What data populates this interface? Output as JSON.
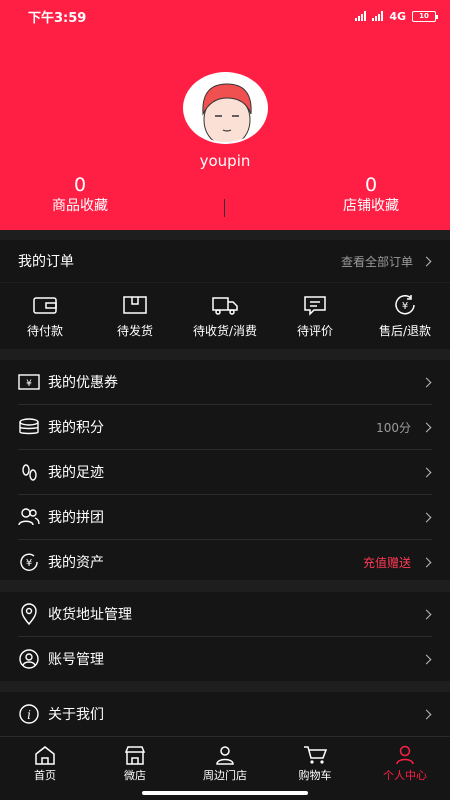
{
  "status_bar": {
    "time": "下午3:59",
    "network": "4G",
    "battery": "10"
  },
  "profile": {
    "username": "youpin"
  },
  "stats": [
    {
      "value": "0",
      "label": "商品收藏"
    },
    {
      "value": "0",
      "label": "店铺收藏"
    }
  ],
  "orders": {
    "title": "我的订单",
    "view_all": "查看全部订单",
    "items": [
      {
        "label": "待付款",
        "icon": "wallet-icon"
      },
      {
        "label": "待发货",
        "icon": "package-icon"
      },
      {
        "label": "待收货/消费",
        "icon": "truck-icon"
      },
      {
        "label": "待评价",
        "icon": "comment-icon"
      },
      {
        "label": "售后/退款",
        "icon": "refund-icon"
      }
    ]
  },
  "menu_group_1": [
    {
      "label": "我的优惠券",
      "extra": "",
      "icon": "coupon-icon"
    },
    {
      "label": "我的积分",
      "extra": "100分",
      "icon": "coins-icon"
    },
    {
      "label": "我的足迹",
      "extra": "",
      "icon": "footprint-icon"
    },
    {
      "label": "我的拼团",
      "extra": "",
      "icon": "group-icon"
    },
    {
      "label": "我的资产",
      "extra": "充值赠送",
      "icon": "assets-icon"
    }
  ],
  "menu_group_2": [
    {
      "label": "收货地址管理",
      "icon": "location-icon"
    },
    {
      "label": "账号管理",
      "icon": "account-icon"
    }
  ],
  "menu_group_3": [
    {
      "label": "关于我们",
      "icon": "info-icon"
    }
  ],
  "tabbar": [
    {
      "label": "首页",
      "icon": "home-icon"
    },
    {
      "label": "微店",
      "icon": "store-icon"
    },
    {
      "label": "周边门店",
      "icon": "nearby-store-icon"
    },
    {
      "label": "购物车",
      "icon": "cart-icon"
    },
    {
      "label": "个人中心",
      "icon": "person-icon"
    }
  ],
  "colors": {
    "accent": "#ff1f45",
    "background": "#1e1e1e",
    "panel": "#151515",
    "promo_text": "#ff3a55"
  }
}
